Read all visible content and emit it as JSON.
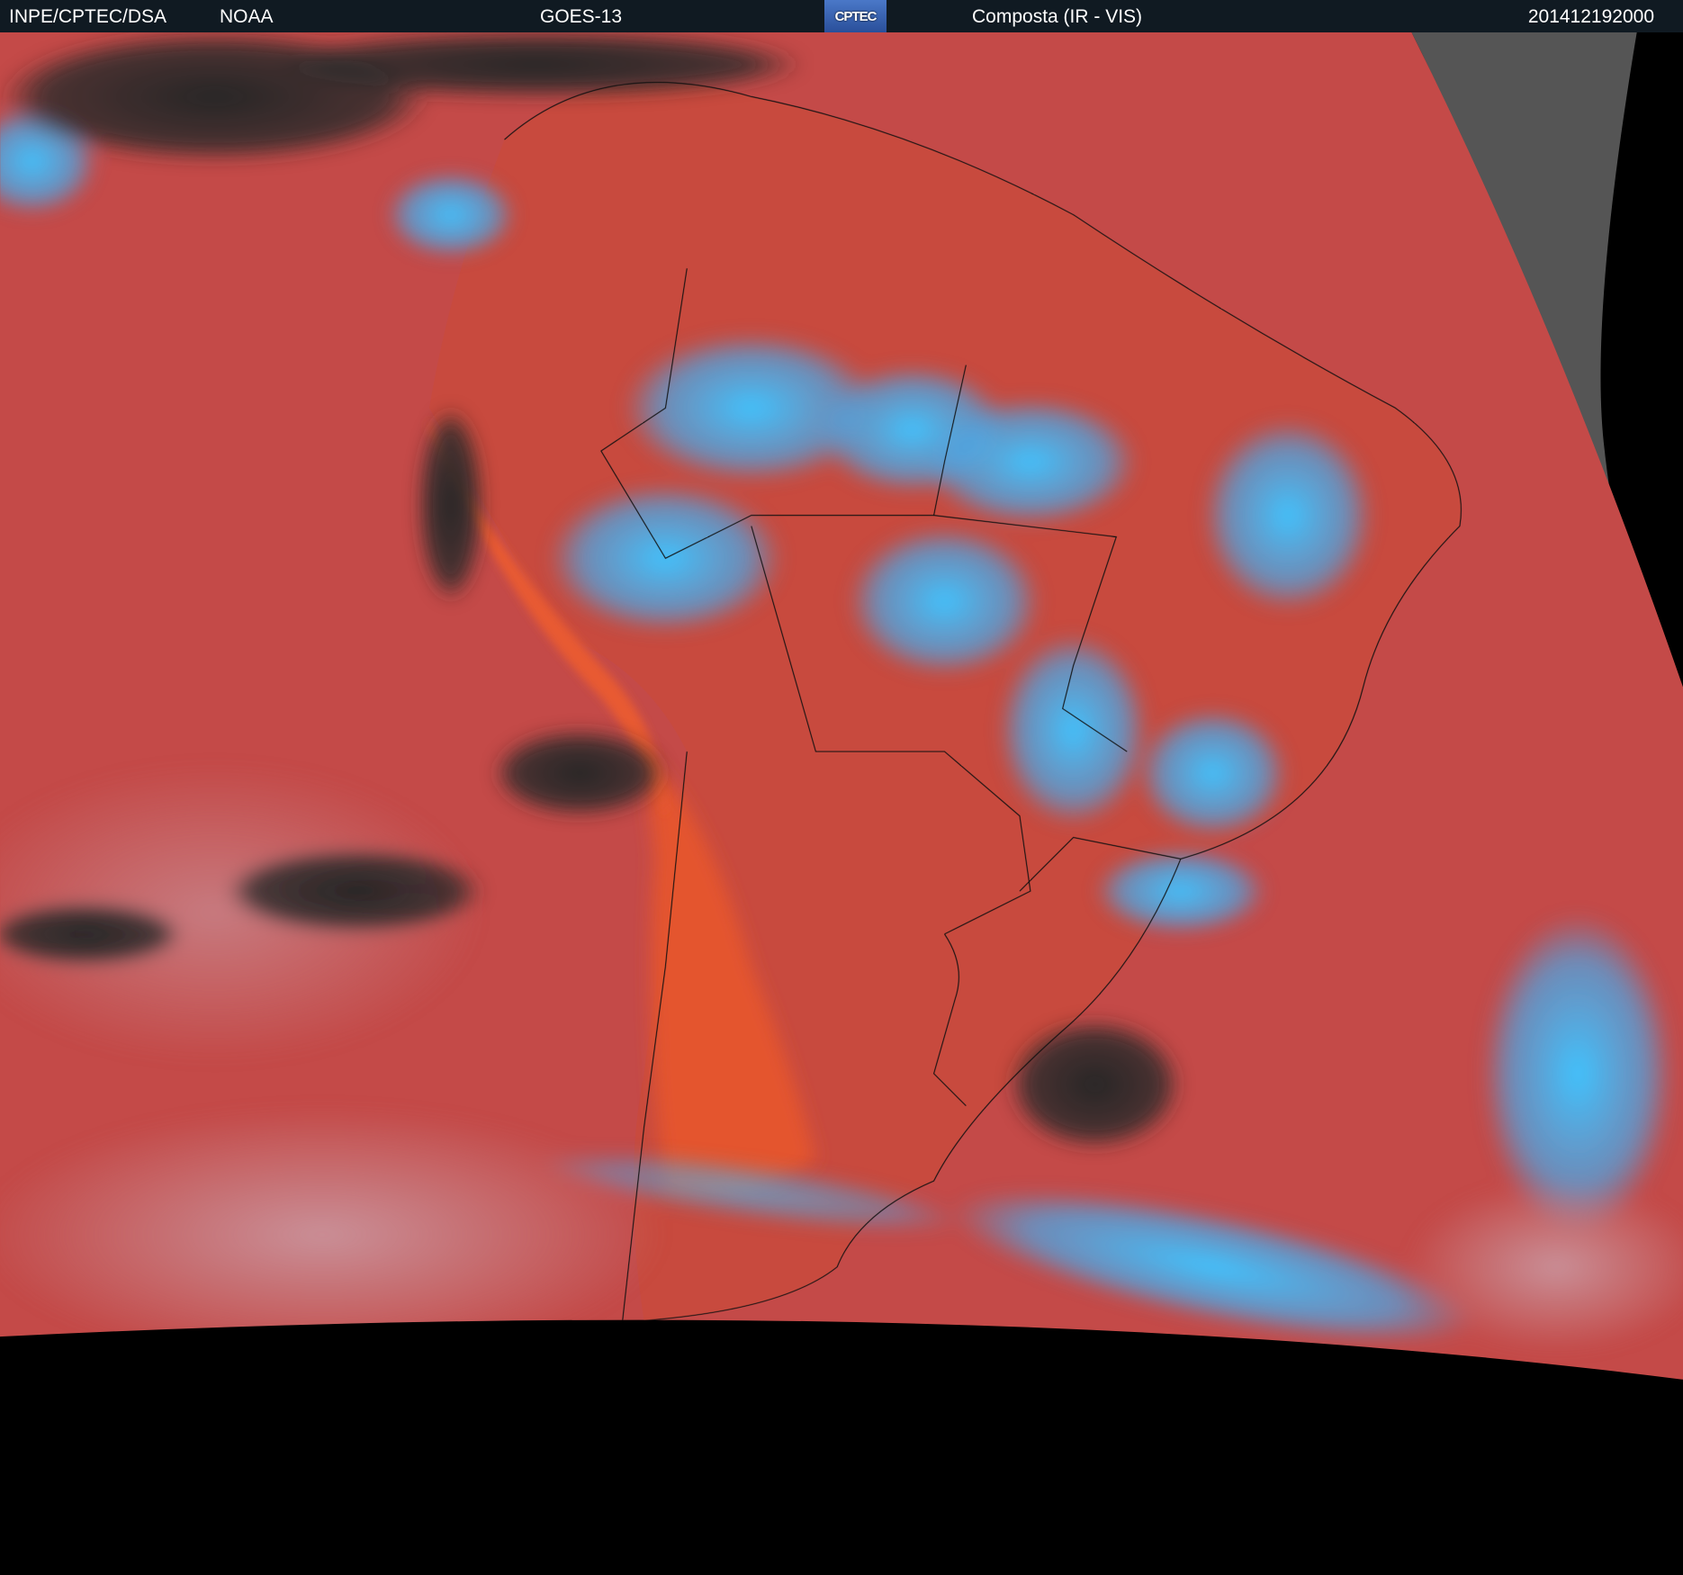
{
  "header": {
    "agency": "INPE/CPTEC/DSA",
    "partner": "NOAA",
    "satellite": "GOES-13",
    "logo_text": "CPTEC",
    "product": "Composta (IR - VIS)",
    "timestamp": "201412192000"
  },
  "colors": {
    "header_bg": "#101a22",
    "ocean_red": "#c44a48",
    "land_orange": "#e4552e",
    "cloud_cyan": "#3cb8f0",
    "clear_dark": "#2c2c2c",
    "outside_disk": "#000000"
  }
}
